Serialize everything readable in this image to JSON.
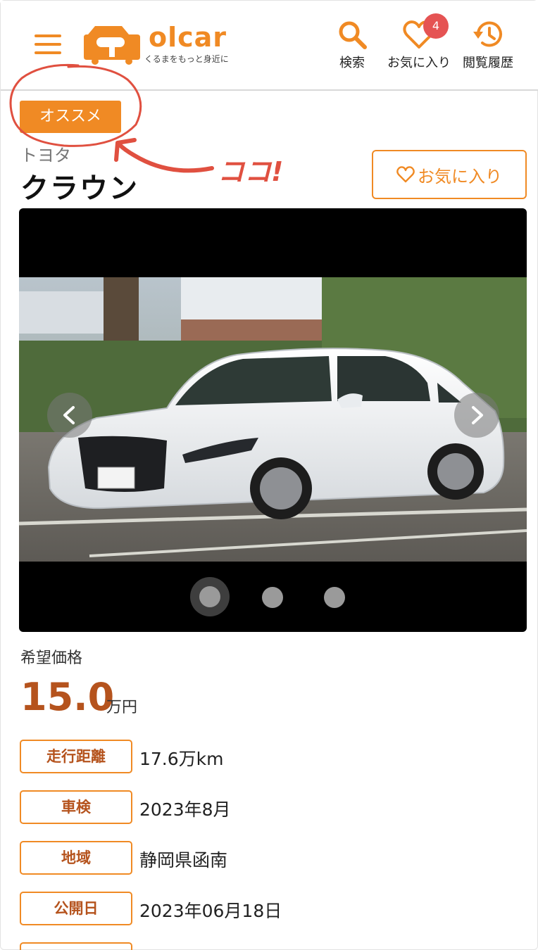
{
  "header": {
    "logo": {
      "name": "olcar",
      "tagline": "くるまをもっと身近に"
    },
    "nav": [
      {
        "label": "検索",
        "icon": "search-icon"
      },
      {
        "label": "お気に入り",
        "icon": "heart-icon",
        "badge": "4"
      },
      {
        "label": "閲覧履歴",
        "icon": "history-icon"
      }
    ]
  },
  "listing": {
    "tag": "オススメ",
    "annotation": "ココ!",
    "maker": "トヨタ",
    "model": "クラウン",
    "favorite_button": "お気に入り"
  },
  "carousel": {
    "slide_count": 3,
    "active_slide": 1
  },
  "price": {
    "label": "希望価格",
    "value": "15.0",
    "unit": "万円"
  },
  "specs": [
    {
      "label": "走行距離",
      "value": "17.6万km"
    },
    {
      "label": "車検",
      "value": "2023年8月"
    },
    {
      "label": "地域",
      "value": "静岡県函南"
    },
    {
      "label": "公開日",
      "value": "2023年06月18日"
    }
  ],
  "colors": {
    "accent": "#f08a24",
    "price": "#b5531d",
    "badge": "#e55353",
    "annotation": "#e05040"
  }
}
